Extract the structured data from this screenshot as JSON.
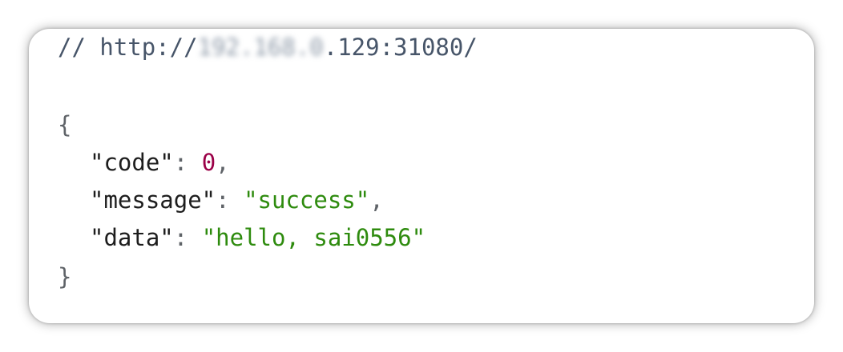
{
  "viewer": {
    "comment_prefix": "// http://",
    "obscured_host": "192.168.0",
    "url_suffix": ".129:31080/",
    "open_brace": "{",
    "close_brace": "}",
    "fields": [
      {
        "key": "\"code\"",
        "sep": ": ",
        "value": "0",
        "type": "number",
        "trail": ","
      },
      {
        "key": "\"message\"",
        "sep": ": ",
        "value": "\"success\"",
        "type": "string",
        "trail": ","
      },
      {
        "key": "\"data\"",
        "sep": ": ",
        "value": "\"hello, sai0556\"",
        "type": "string",
        "trail": ""
      }
    ]
  },
  "colors": {
    "number": "#9b0047",
    "string": "#2e8b0e",
    "key": "#1d1d1d",
    "comment": "#475569"
  }
}
